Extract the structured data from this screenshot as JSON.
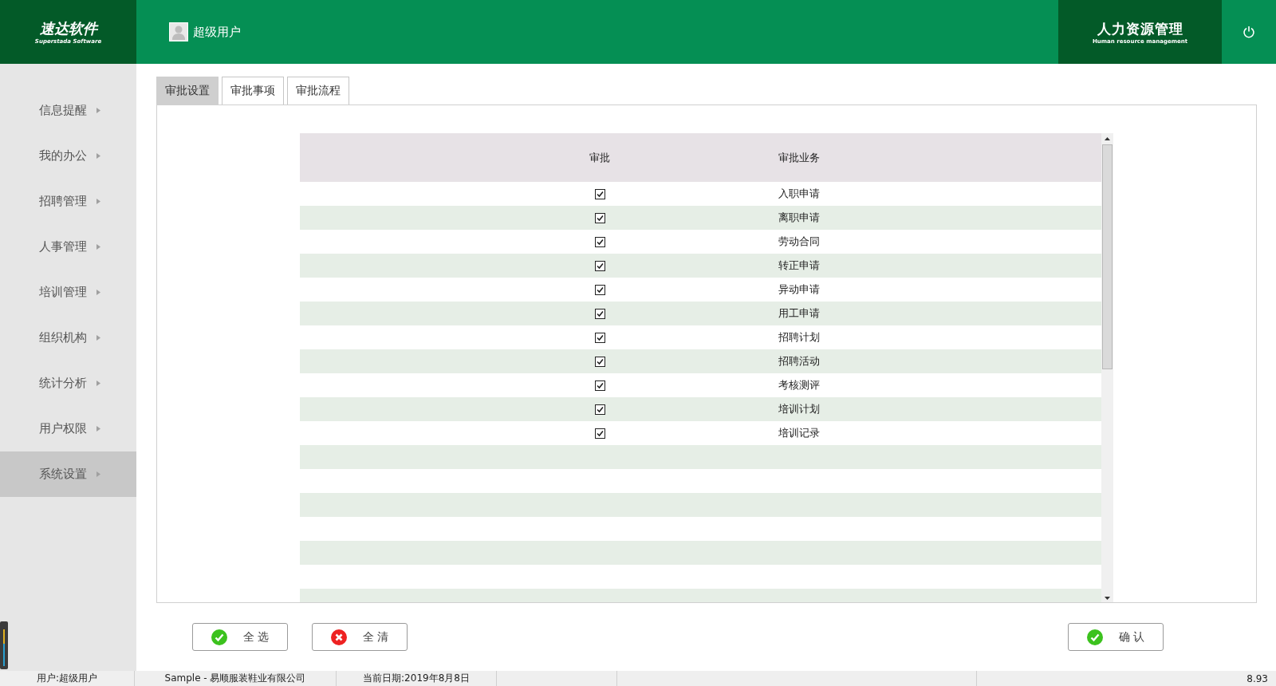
{
  "header": {
    "logo_title": "速达软件",
    "logo_subtitle": "Superstada Software",
    "user": "超级用户",
    "module_title": "人力资源管理",
    "module_subtitle": "Human resource management"
  },
  "sidebar": {
    "items": [
      {
        "label": "信息提醒",
        "selected": false
      },
      {
        "label": "我的办公",
        "selected": false
      },
      {
        "label": "招聘管理",
        "selected": false
      },
      {
        "label": "人事管理",
        "selected": false
      },
      {
        "label": "培训管理",
        "selected": false
      },
      {
        "label": "组织机构",
        "selected": false
      },
      {
        "label": "统计分析",
        "selected": false
      },
      {
        "label": "用户权限",
        "selected": false
      },
      {
        "label": "系统设置",
        "selected": true
      }
    ]
  },
  "tabs": [
    {
      "label": "审批设置",
      "selected": true
    },
    {
      "label": "审批事项",
      "selected": false
    },
    {
      "label": "审批流程",
      "selected": false
    }
  ],
  "table": {
    "columns": [
      "审批",
      "审批业务"
    ],
    "rows": [
      {
        "checked": true,
        "business": "入职申请"
      },
      {
        "checked": true,
        "business": "离职申请"
      },
      {
        "checked": true,
        "business": "劳动合同"
      },
      {
        "checked": true,
        "business": "转正申请"
      },
      {
        "checked": true,
        "business": "异动申请"
      },
      {
        "checked": true,
        "business": "用工申请"
      },
      {
        "checked": true,
        "business": "招聘计划"
      },
      {
        "checked": true,
        "business": "招聘活动"
      },
      {
        "checked": true,
        "business": "考核测评"
      },
      {
        "checked": true,
        "business": "培训计划"
      },
      {
        "checked": true,
        "business": "培训记录"
      }
    ]
  },
  "buttons": [
    {
      "label": "全 选",
      "kind": "ok"
    },
    {
      "label": "全 清",
      "kind": "cancel"
    },
    {
      "label": "确 认",
      "kind": "ok"
    }
  ],
  "status_bar": {
    "user": "用户:超级用户",
    "company": "Sample - 易顺服装鞋业有限公司",
    "date": "当前日期:2019年8月8日",
    "version": "8.93"
  }
}
